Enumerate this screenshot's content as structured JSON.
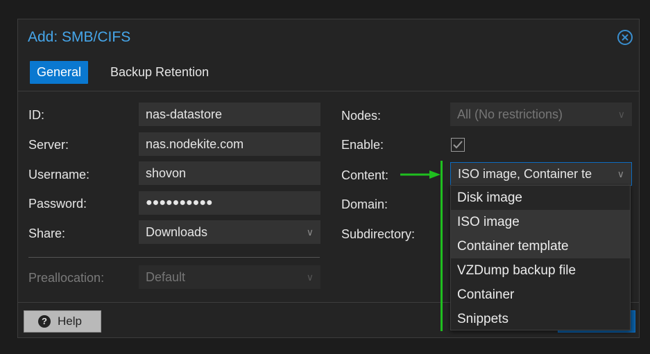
{
  "dialog": {
    "title": "Add: SMB/CIFS",
    "close_icon": "close-circle-icon"
  },
  "tabs": [
    {
      "label": "General",
      "active": true
    },
    {
      "label": "Backup Retention",
      "active": false
    }
  ],
  "left_form": {
    "id": {
      "label": "ID:",
      "value": "nas-datastore"
    },
    "server": {
      "label": "Server:",
      "value": "nas.nodekite.com"
    },
    "username": {
      "label": "Username:",
      "value": "shovon"
    },
    "password": {
      "label": "Password:",
      "value": "●●●●●●●●●●"
    },
    "share": {
      "label": "Share:",
      "value": "Downloads"
    }
  },
  "right_form": {
    "nodes": {
      "label": "Nodes:",
      "value": "All (No restrictions)"
    },
    "enable": {
      "label": "Enable:",
      "checked": true
    },
    "content": {
      "label": "Content:",
      "value": "ISO image, Container te"
    },
    "domain": {
      "label": "Domain:"
    },
    "subdirectory": {
      "label": "Subdirectory:"
    }
  },
  "preallocation": {
    "label": "Preallocation:",
    "value": "Default"
  },
  "content_options": [
    {
      "label": "Disk image",
      "selected": false
    },
    {
      "label": "ISO image",
      "selected": true
    },
    {
      "label": "Container template",
      "selected": true
    },
    {
      "label": "VZDump backup file",
      "selected": false
    },
    {
      "label": "Container",
      "selected": false
    },
    {
      "label": "Snippets",
      "selected": false
    }
  ],
  "footer": {
    "help_label": "Help",
    "help_icon": "question-circle-icon"
  },
  "colors": {
    "accent": "#0a78d0",
    "title": "#46a6ea",
    "annotation": "#1fbf1f"
  }
}
